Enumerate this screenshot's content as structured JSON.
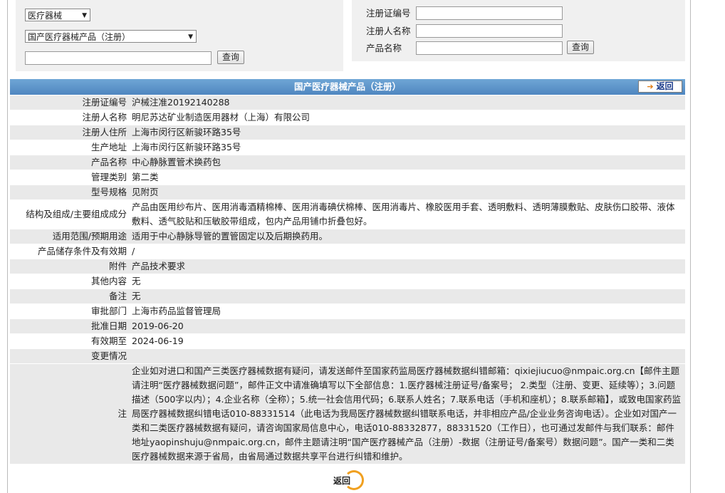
{
  "search": {
    "category_select": "医疗器械",
    "product_select": "国产医疗器械产品（注册）",
    "keyword_value": "",
    "query_label": "查询",
    "reg_no_label": "注册证编号",
    "registrant_label": "注册人名称",
    "product_name_label": "产品名称",
    "query_label_right": "查询"
  },
  "header": {
    "title": "国产医疗器械产品（注册）",
    "back_label": "返回"
  },
  "rows": [
    {
      "k": "注册证编号",
      "v": "沪械注准20192140288"
    },
    {
      "k": "注册人名称",
      "v": "明尼苏达矿业制造医用器材（上海）有限公司"
    },
    {
      "k": "注册人住所",
      "v": "上海市闵行区新骏环路35号"
    },
    {
      "k": "生产地址",
      "v": "上海市闵行区新骏环路35号"
    },
    {
      "k": "产品名称",
      "v": "中心静脉置管术换药包"
    },
    {
      "k": "管理类别",
      "v": "第二类"
    },
    {
      "k": "型号规格",
      "v": "见附页"
    },
    {
      "k": "结构及组成/主要组成成分",
      "v": "产品由医用纱布片、医用消毒酒精棉棒、医用消毒碘伏棉棒、医用消毒片、橡胶医用手套、透明敷料、透明薄膜敷贴、皮肤伤口胶带、液体敷料、透气胶贴和压敏胶带组成，包内产品用铺巾折叠包好。"
    },
    {
      "k": "适用范围/预期用途",
      "v": "适用于中心静脉导管的置管固定以及后期换药用。"
    },
    {
      "k": "产品储存条件及有效期",
      "v": "/"
    },
    {
      "k": "附件",
      "v": "产品技术要求"
    },
    {
      "k": "其他内容",
      "v": "无"
    },
    {
      "k": "备注",
      "v": "无"
    },
    {
      "k": "审批部门",
      "v": "上海市药品监督管理局"
    },
    {
      "k": "批准日期",
      "v": "2019-06-20"
    },
    {
      "k": "有效期至",
      "v": "2024-06-19"
    },
    {
      "k": "变更情况",
      "v": ""
    }
  ],
  "note": {
    "k": "注",
    "v": "企业如对进口和国产三类医疗器械数据有疑问，请发送邮件至国家药监局医疗器械数据纠错邮箱：qixiejiucuo@nmpaic.org.cn【邮件主题请注明“医疗器械数据问题”，邮件正文中请准确填写以下全部信息：1.医疗器械注册证号/备案号； 2.类型（注册、变更、延续等）；3.问题描述（500字以内）；4.企业名称（全称）；5.统一社会信用代码；6.联系人姓名；7.联系电话（手机和座机）；8.联系邮箱】，或致电国家药监局医疗器械数据纠错电话010-88331514（此电话为我局医疗器械数据纠错联系电话，并非相应产品/企业业务咨询电话）。企业如对国产一类和二类医疗器械数据有疑问，请咨询国家局信息中心，电话010-88332877，88331520（工作日），也可通过发邮件与我们联系：邮件地址yaopinshuju@nmpaic.org.cn，邮件主题请注明“国产医疗器械产品（注册）-数据（注册证号/备案号）数据问题”。国产一类和二类医疗器械数据来源于省局，由省局通过数据共享平台进行纠错和维护。"
  },
  "footer": {
    "back_label": "返回"
  }
}
